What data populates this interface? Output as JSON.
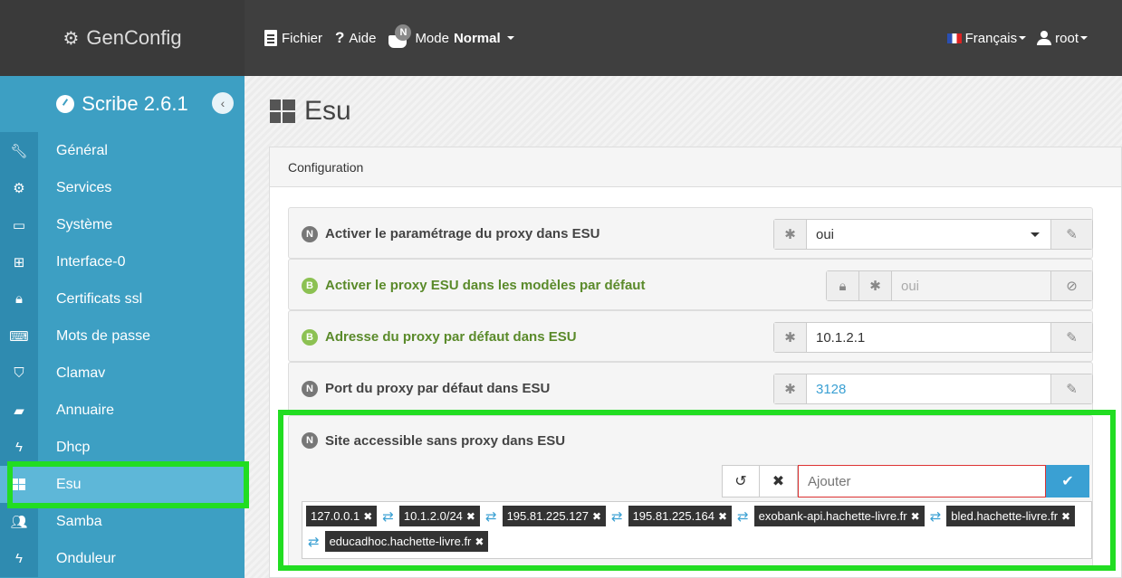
{
  "topbar": {
    "brand": "GenConfig",
    "menu": {
      "file": "Fichier",
      "help": "Aide",
      "mode_badge": "N",
      "mode_label": "Mode",
      "mode_value": "Normal"
    },
    "language": "Français",
    "user": "root"
  },
  "sidebar": {
    "title": "Scribe 2.6.1",
    "items": [
      {
        "label": "Général",
        "icon": "wrench-icon"
      },
      {
        "label": "Services",
        "icon": "cogs-icon"
      },
      {
        "label": "Système",
        "icon": "monitor-icon"
      },
      {
        "label": "Interface-0",
        "icon": "network-icon"
      },
      {
        "label": "Certificats ssl",
        "icon": "lock-icon"
      },
      {
        "label": "Mots de passe",
        "icon": "keyboard-icon"
      },
      {
        "label": "Clamav",
        "icon": "shield-icon"
      },
      {
        "label": "Annuaire",
        "icon": "book-icon"
      },
      {
        "label": "Dhcp",
        "icon": "bolt-icon"
      },
      {
        "label": "Esu",
        "icon": "windows-icon"
      },
      {
        "label": "Samba",
        "icon": "users-icon"
      },
      {
        "label": "Onduleur",
        "icon": "bolt-icon"
      }
    ],
    "active_item": "Esu"
  },
  "main": {
    "title": "Esu",
    "panel_title": "Configuration",
    "fields": [
      {
        "badge": "N",
        "label": "Activer le paramétrage du proxy dans ESU",
        "value": "oui"
      },
      {
        "badge": "B",
        "label": "Activer le proxy ESU dans les modèles par défaut",
        "value": "oui"
      },
      {
        "badge": "B",
        "label": "Adresse du proxy par défaut dans ESU",
        "value": "10.1.2.1"
      },
      {
        "badge": "N",
        "label": "Port du proxy par défaut dans ESU",
        "value": "3128"
      }
    ],
    "site": {
      "badge": "N",
      "label": "Site accessible sans proxy dans ESU",
      "placeholder": "Ajouter",
      "tags": [
        "127.0.0.1",
        "10.1.2.0/24",
        "195.81.225.127",
        "195.81.225.164",
        "exobank-api.hachette-livre.fr",
        "bled.hachette-livre.fr",
        "educadhoc.hachette-livre.fr"
      ]
    }
  },
  "colors": {
    "topbar": "#3f3f3f",
    "sidebar": "#3d9fc3",
    "accent": "#3aa0d3",
    "highlight": "#22dd22",
    "basic_badge": "#8cc152"
  }
}
